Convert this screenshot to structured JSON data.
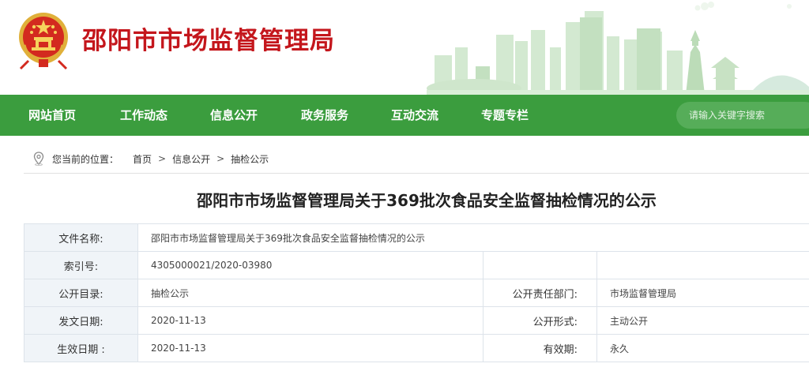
{
  "header": {
    "site_title": "邵阳市市场监督管理局"
  },
  "nav": {
    "items": [
      "网站首页",
      "工作动态",
      "信息公开",
      "政务服务",
      "互动交流",
      "专题专栏"
    ]
  },
  "search": {
    "placeholder": "请输入关键字搜索"
  },
  "breadcrumb": {
    "prefix": "您当前的位置：",
    "items": [
      "首页",
      "信息公开",
      "抽检公示"
    ],
    "separator": ">"
  },
  "document": {
    "title": "邵阳市市场监督管理局关于369批次食品安全监督抽检情况的公示",
    "info": {
      "file_name_label": "文件名称:",
      "file_name": "邵阳市市场监督管理局关于369批次食品安全监督抽检情况的公示",
      "index_label": "索引号:",
      "index": "4305000021/2020-03980",
      "catalog_label": "公开目录:",
      "catalog": "抽检公示",
      "dept_label": "公开责任部门:",
      "dept": "市场监督管理局",
      "issue_date_label": "发文日期:",
      "issue_date": "2020-11-13",
      "form_label": "公开形式:",
      "form": "主动公开",
      "effective_date_label": "生效日期 :",
      "effective_date": "2020-11-13",
      "validity_label": "有效期:",
      "validity": "永久"
    }
  },
  "colors": {
    "brand_red": "#c4161c",
    "nav_green": "#3b9d3e",
    "label_bg": "#f0f4f8"
  }
}
